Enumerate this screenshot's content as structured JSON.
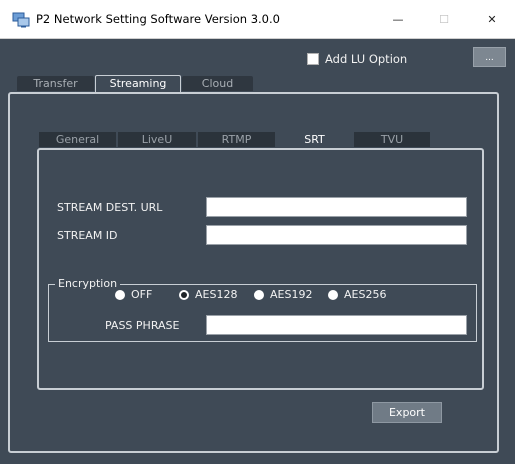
{
  "window": {
    "title": "P2 Network Setting Software  Version 3.0.0",
    "icon": "network-settings-icon",
    "minimize_glyph": "—",
    "maximize_glyph": "☐",
    "close_glyph": "✕"
  },
  "options": {
    "add_lu_label": "Add LU Option",
    "add_lu_checked": false,
    "more_button_label": "..."
  },
  "main_tabs": [
    {
      "label": "Transfer",
      "active": false
    },
    {
      "label": "Streaming",
      "active": true
    },
    {
      "label": "Cloud",
      "active": false
    }
  ],
  "sub_tabs": [
    {
      "label": "General",
      "active": false
    },
    {
      "label": "LiveU",
      "active": false
    },
    {
      "label": "RTMP",
      "active": false
    },
    {
      "label": "SRT",
      "active": true
    },
    {
      "label": "TVU",
      "active": false
    }
  ],
  "srt": {
    "stream_dest_url_label": "STREAM DEST. URL",
    "stream_dest_url_value": "",
    "stream_id_label": "STREAM ID",
    "stream_id_value": "",
    "encryption": {
      "legend": "Encryption",
      "options": [
        "OFF",
        "AES128",
        "AES192",
        "AES256"
      ],
      "selected": "AES128"
    },
    "pass_phrase_label": "PASS PHRASE",
    "pass_phrase_value": ""
  },
  "export_label": "Export",
  "colors": {
    "background": "#3f4a56",
    "tab_inactive": "#2f3740",
    "border": "#c8ced4",
    "button": "#707b86"
  }
}
